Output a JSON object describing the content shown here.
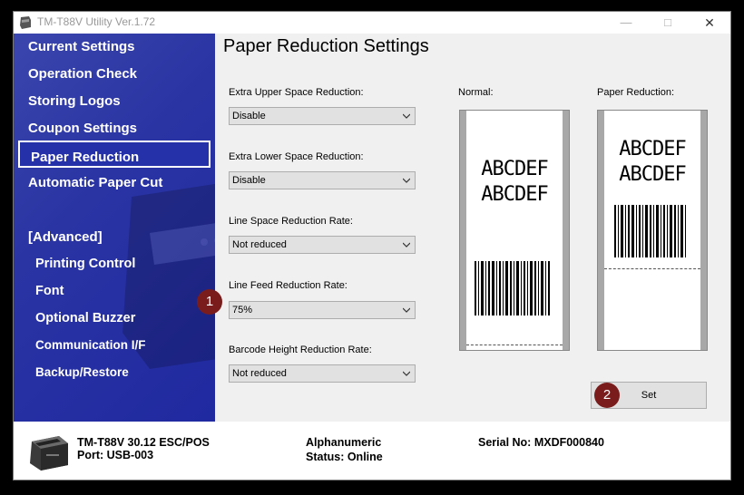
{
  "window": {
    "title": "TM-T88V Utility Ver.1.72"
  },
  "sidebar": {
    "items": [
      {
        "label": "Current Settings"
      },
      {
        "label": "Operation Check"
      },
      {
        "label": "Storing Logos"
      },
      {
        "label": "Coupon Settings"
      },
      {
        "label": "Paper Reduction",
        "selected": true
      },
      {
        "label": "Automatic Paper Cut"
      }
    ],
    "advanced_heading": "[Advanced]",
    "advanced_items": [
      {
        "label": "Printing Control"
      },
      {
        "label": "Font"
      },
      {
        "label": "Optional Buzzer"
      },
      {
        "label": "Communication I/F"
      },
      {
        "label": "Backup/Restore"
      }
    ]
  },
  "main": {
    "heading": "Paper Reduction Settings",
    "fields": [
      {
        "label": "Extra Upper Space Reduction:",
        "value": "Disable"
      },
      {
        "label": "Extra Lower Space Reduction:",
        "value": "Disable"
      },
      {
        "label": "Line Space Reduction Rate:",
        "value": "Not reduced"
      },
      {
        "label": "Line Feed Reduction Rate:",
        "value": "75%"
      },
      {
        "label": "Barcode Height Reduction Rate:",
        "value": "Not reduced"
      }
    ],
    "preview_normal_label": "Normal:",
    "preview_reduced_label": "Paper Reduction:",
    "sample_line1": "ABCDEF",
    "sample_line2": "ABCDEF",
    "set_label": "Set",
    "callout_1": "1",
    "callout_2": "2"
  },
  "status": {
    "model": "TM-T88V 30.12 ESC/POS",
    "port": "Port: USB-003",
    "font_mode": "Alphanumeric",
    "status": "Status: Online",
    "serial": "Serial No: MXDF000840"
  },
  "colors": {
    "sidebar": "#2a34a3",
    "badge": "#7a1c1c"
  }
}
